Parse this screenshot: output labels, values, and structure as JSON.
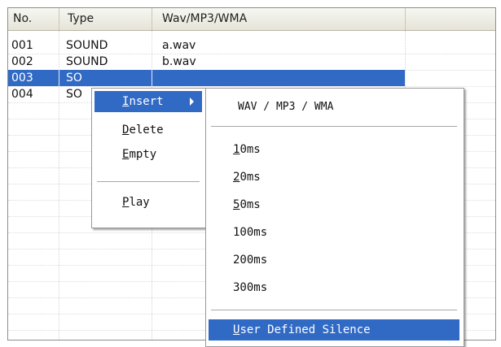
{
  "table": {
    "columns": [
      "No.",
      "Type",
      "Wav/MP3/WMA"
    ],
    "rows": [
      {
        "no": "001",
        "type": "SOUND",
        "file": "a.wav"
      },
      {
        "no": "002",
        "type": "SOUND",
        "file": "b.wav"
      },
      {
        "no": "003",
        "type": "SO",
        "file": ""
      },
      {
        "no": "004",
        "type": "SO",
        "file": ""
      }
    ],
    "selected_row": "003"
  },
  "context_menu": {
    "items": [
      {
        "pre": "",
        "acc": "I",
        "post": "nsert",
        "has_submenu": true
      },
      {
        "pre": "",
        "acc": "D",
        "post": "elete"
      },
      {
        "pre": "",
        "acc": "E",
        "post": "mpty"
      },
      {
        "pre": "",
        "acc": "P",
        "post": "lay"
      }
    ]
  },
  "submenu": {
    "header": "WAV / MP3 / WMA",
    "items": [
      {
        "pre": "",
        "acc": "1",
        "post": "0ms"
      },
      {
        "pre": "",
        "acc": "2",
        "post": "0ms"
      },
      {
        "pre": "",
        "acc": "5",
        "post": "0ms"
      },
      {
        "pre": "",
        "acc": "",
        "post": "100ms"
      },
      {
        "pre": "",
        "acc": "",
        "post": "200ms"
      },
      {
        "pre": "",
        "acc": "",
        "post": "300ms"
      }
    ],
    "footer": {
      "pre": "",
      "acc": "U",
      "post": "ser Defined Silence"
    }
  },
  "colors": {
    "selection": "#316ac5",
    "header_bg": "#ece9d8"
  }
}
